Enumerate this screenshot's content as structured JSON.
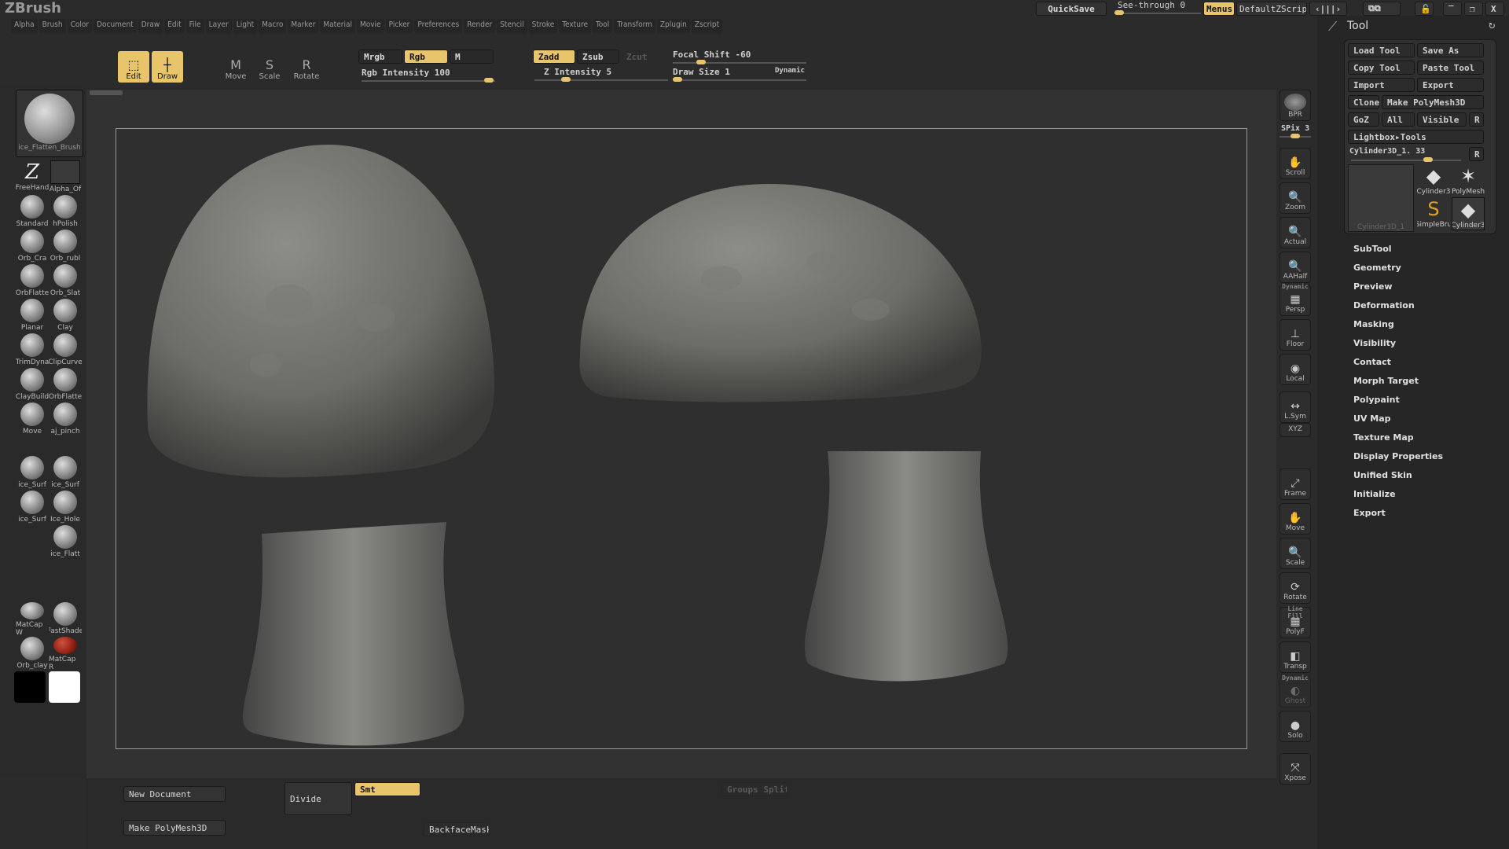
{
  "app": {
    "title": "ZBrush"
  },
  "menus": [
    "Alpha",
    "Brush",
    "Color",
    "Document",
    "Draw",
    "Edit",
    "File",
    "Layer",
    "Light",
    "Macro",
    "Marker",
    "Material",
    "Movie",
    "Picker",
    "Preferences",
    "Render",
    "Stencil",
    "Stroke",
    "Texture",
    "Tool",
    "Transform",
    "Zplugin",
    "Zscript"
  ],
  "topright": {
    "quicksave": "QuickSave",
    "seethrough_label": "See-through",
    "seethrough_value": "0",
    "menus": "Menus",
    "script": "DefaultZScript"
  },
  "toolbar": {
    "edit": "Edit",
    "draw": "Draw",
    "move": "Move",
    "scale": "Scale",
    "rotate": "Rotate",
    "mrgb": "Mrgb",
    "rgb": "Rgb",
    "m": "M",
    "rgb_intensity": "Rgb Intensity 100",
    "zadd": "Zadd",
    "zsub": "Zsub",
    "zcut": "Zcut",
    "z_intensity": "Z Intensity 5",
    "focal_shift": "Focal Shift -60",
    "draw_size": "Draw Size 1",
    "dynamic": "Dynamic",
    "rgb_intensity_value": 100,
    "z_intensity_value": 5,
    "focal_shift_value": -60,
    "draw_size_value": 1
  },
  "leftshelf": {
    "current_brush": "ice_Flatten_Brush",
    "stroke": "FreeHand",
    "alpha": "Alpha_Of",
    "brushes": [
      "Standard",
      "hPolish",
      "Orb_Cra",
      "Orb_rubl",
      "OrbFlatte",
      "Orb_Slat",
      "Planar",
      "Clay",
      "TrimDyna",
      "ClipCurve",
      "ClayBuild",
      "OrbFlatte",
      "Move",
      "aj_pinch",
      "ice_Surf",
      "ice_Surf",
      "ice_Surf",
      "Ice_Hole",
      "ice_Flatt"
    ],
    "materials": [
      "MatCap W",
      "FastShade",
      "Orb_clay",
      "MatCap R"
    ],
    "colors": {
      "primary": "#000000",
      "secondary": "#ffffff"
    }
  },
  "rightshelf": {
    "bpr": "BPR",
    "spix": "SPix 3",
    "items": [
      "Scroll",
      "Zoom",
      "Actual",
      "AAHalf",
      "Persp",
      "Floor",
      "Local",
      "L.Sym",
      "XYZ",
      "Frame",
      "Move",
      "Scale",
      "Rotate",
      "PolyF",
      "Transp",
      "Ghost",
      "Solo",
      "Xpose"
    ],
    "persp_dynamic": "Dynamic",
    "polyf_header": "Line Fill",
    "solo_dynamic": "Dynamic"
  },
  "toolpanel": {
    "title": "Tool",
    "load": "Load Tool",
    "saveas": "Save As",
    "copy": "Copy Tool",
    "paste": "Paste Tool",
    "import": "Import",
    "export": "Export",
    "clone": "Clone",
    "makepoly": "Make PolyMesh3D",
    "goz": "GoZ",
    "all": "All",
    "visible": "Visible",
    "r": "R",
    "lightbox": "Lightbox▸Tools",
    "current": "Cylinder3D_1. 33",
    "current_value": 33,
    "thumbs": [
      "Cylinder3D_1",
      "Cylinder3",
      "PolyMesh",
      "SimpleBru",
      "Cylinder3"
    ],
    "sections": [
      "SubTool",
      "Geometry",
      "Preview",
      "Deformation",
      "Masking",
      "Visibility",
      "Contact",
      "Morph Target",
      "Polypaint",
      "UV Map",
      "Texture Map",
      "Display Properties",
      "Unified Skin",
      "Initialize",
      "Export"
    ]
  },
  "bottom": {
    "newdoc": "New Document",
    "makepoly": "Make PolyMesh3D",
    "divide": "Divide",
    "smt": "Smt",
    "backface": "BackfaceMask",
    "groups": "Groups Split"
  },
  "accent": "#e8c56a"
}
